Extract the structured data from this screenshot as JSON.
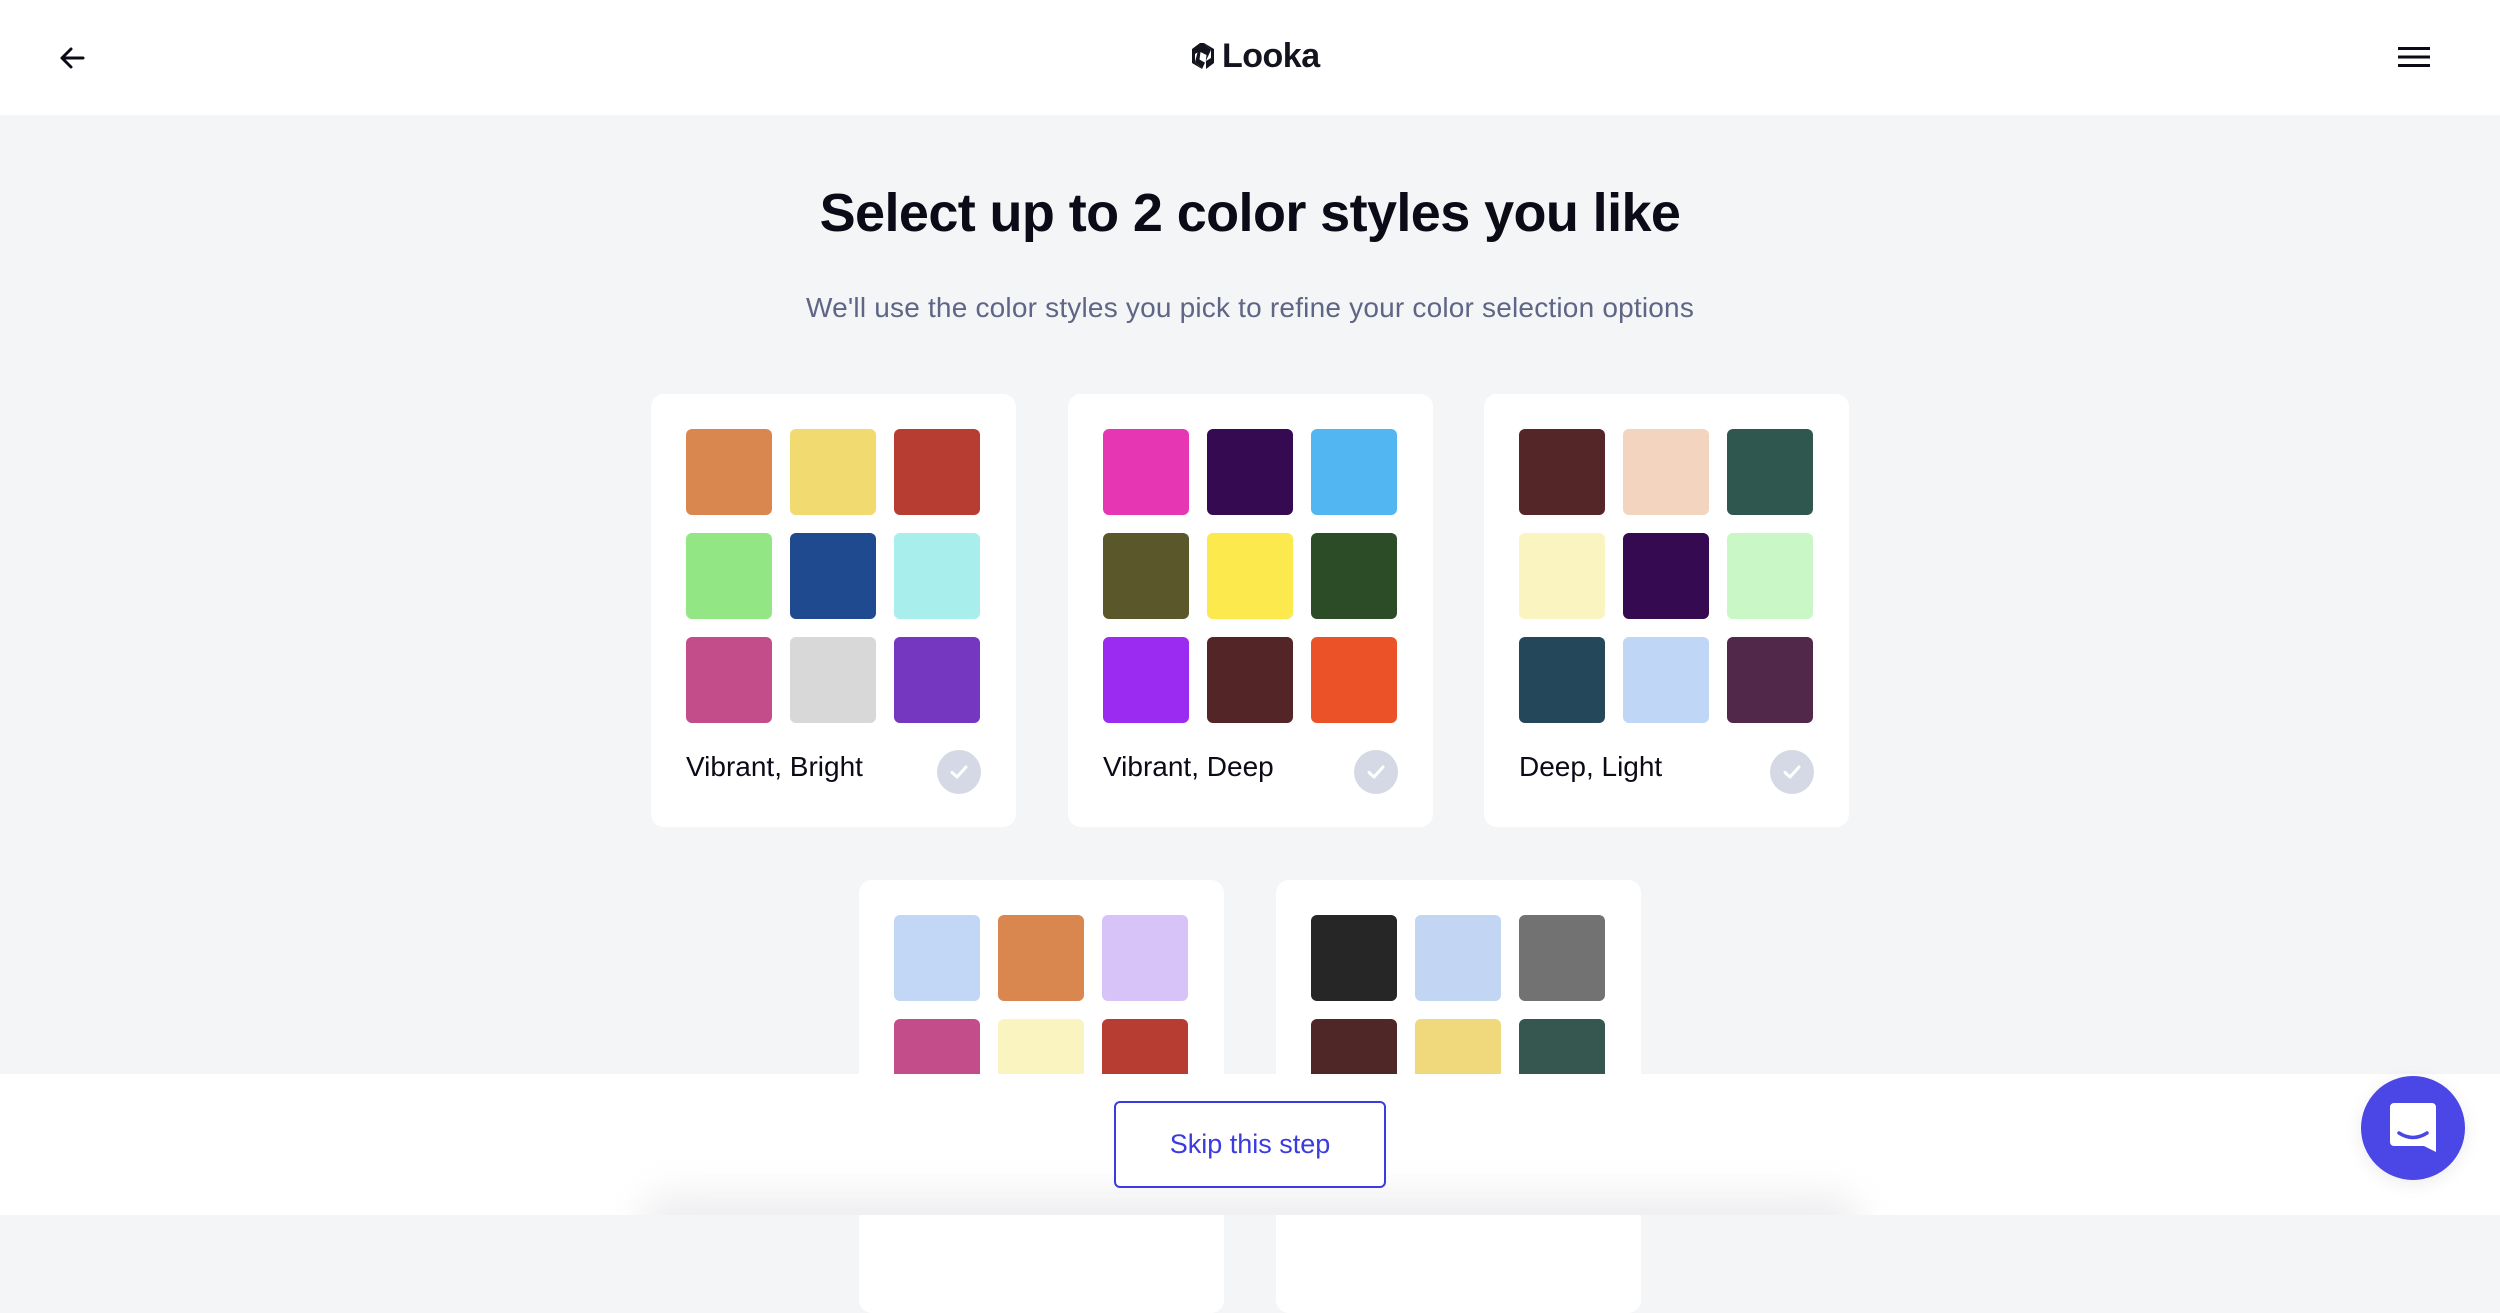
{
  "header": {
    "back_icon": "arrow-left-icon",
    "brand_name": "Looka",
    "brand_icon": "looka-logo-icon",
    "menu_icon": "hamburger-menu-icon"
  },
  "main": {
    "title": "Select up to 2 color styles you like",
    "subtitle": "We'll use the color styles you pick to refine your color selection options",
    "check_icon": "checkmark-icon",
    "cards": [
      {
        "label": "Vibrant, Bright",
        "selected": false,
        "swatches": [
          "#d9874e",
          "#f1da6f",
          "#b73d32",
          "#92e684",
          "#204a8f",
          "#a8eeed",
          "#c24d8a",
          "#d8d8d8",
          "#7536c0"
        ]
      },
      {
        "label": "Vibrant, Deep",
        "selected": false,
        "swatches": [
          "#e636b4",
          "#350a51",
          "#52b6f2",
          "#5a572b",
          "#fbe94d",
          "#2b4c26",
          "#9b2bf0",
          "#532526",
          "#ec5228"
        ]
      },
      {
        "label": "Deep, Light",
        "selected": false,
        "swatches": [
          "#552627",
          "#f3d4bf",
          "#30574f",
          "#faf4c1",
          "#350a51",
          "#c9f7c6",
          "#25475a",
          "#bfd6f6",
          "#51284a"
        ]
      },
      {
        "label": "",
        "selected": false,
        "swatches": [
          "#c2d6f6",
          "#d9874e",
          "#d8c3f8",
          "#c24d8a",
          "#faf4c1",
          "#b73d32"
        ]
      },
      {
        "label": "",
        "selected": false,
        "swatches": [
          "#262626",
          "#c2d6f3",
          "#727272",
          "#4f2726",
          "#f0d97c",
          "#365750"
        ]
      }
    ]
  },
  "footer": {
    "skip_label": "Skip this step"
  },
  "chat": {
    "icon": "chat-bubble-icon"
  },
  "colors": {
    "accent": "#3b3be0",
    "chat": "#4b46e6",
    "background": "#f4f5f7",
    "check_inactive": "#d5d9e5"
  }
}
